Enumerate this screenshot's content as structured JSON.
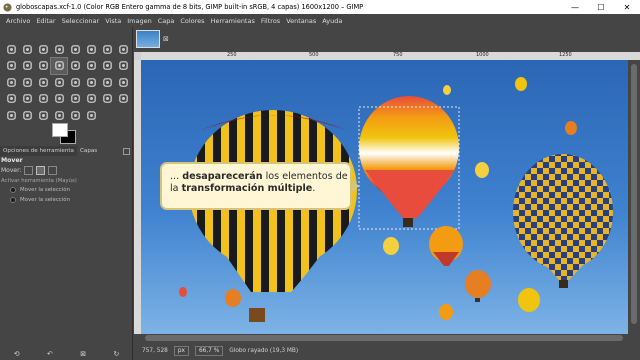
{
  "window": {
    "title": "globoscapas.xcf-1.0 (Color RGB Entero gamma de 8 bits, GIMP built-in sRGB, 4 capas) 1600x1200 – GIMP",
    "minimize": "—",
    "maximize": "☐",
    "close": "✕"
  },
  "menu": [
    "Archivo",
    "Editar",
    "Seleccionar",
    "Vista",
    "Imagen",
    "Capa",
    "Colores",
    "Herramientas",
    "Filtros",
    "Ventanas",
    "Ayuda"
  ],
  "tools": [
    "rect-select-icon",
    "ellipse-select-icon",
    "lasso-icon",
    "fuzzy-select-icon",
    "scissors-icon",
    "foreground-select-icon",
    "color-select-icon",
    "paths-icon",
    "color-picker-icon",
    "zoom-icon",
    "measure-icon",
    "move-icon",
    "align-icon",
    "crop-icon",
    "rotate-icon",
    "scale-icon",
    "shear-icon",
    "perspective-icon",
    "unified-transform-icon",
    "handle-transform-icon",
    "flip-icon",
    "cage-icon",
    "warp-icon",
    "text-icon",
    "bucket-fill-icon",
    "gradient-icon",
    "pencil-icon",
    "paintbrush-icon",
    "eraser-icon",
    "airbrush-icon",
    "ink-icon",
    "mypaint-brush-icon",
    "clone-icon",
    "perspective-clone-icon",
    "heal-icon",
    "blur-icon",
    "smudge-icon",
    "dodge-burn-icon"
  ],
  "dock": {
    "tab_options": "Opciones de herramienta",
    "tab_layers": "Capas"
  },
  "tool_options": {
    "title": "Mover",
    "move_label": "Mover:",
    "toggle_label": "Activar herramienta (Mayús)",
    "radio1": "Mover la selección",
    "radio2": "Mover la selección"
  },
  "toolbox_bottom": [
    "⟲",
    "↶",
    "⊠",
    "↻"
  ],
  "ruler_ticks": [
    "250",
    "500",
    "750",
    "1000",
    "1250"
  ],
  "callout": {
    "pre": "... ",
    "bold1": "desaparecerán",
    "mid": " los elementos de la ",
    "bold2": "transformación múltiple",
    "post": "."
  },
  "status": {
    "coords": "757, 528",
    "unit": "px",
    "zoom": "66,7 %",
    "info": "Globo rayado (19,3 MB)"
  },
  "colors": {
    "sky_top": "#2b66b5",
    "sky_bottom": "#7db3e6",
    "ui_bg": "#454545",
    "callout_bg": "#fff6d6",
    "callout_border": "#d6c47a"
  }
}
